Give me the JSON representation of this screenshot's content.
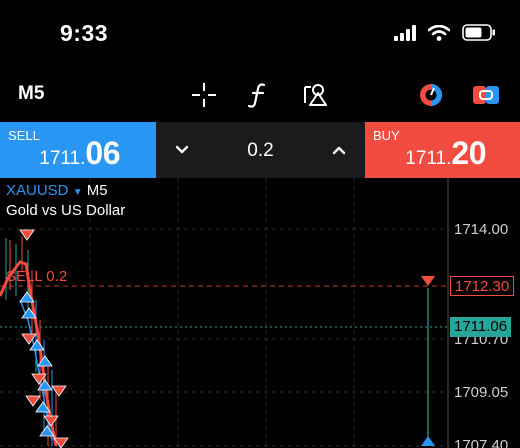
{
  "status_bar": {
    "time": "9:33",
    "icons": [
      "cellular-signal-icon",
      "wifi-icon",
      "battery-icon"
    ]
  },
  "toolbar": {
    "timeframe": "M5",
    "tools": [
      "crosshair-icon",
      "indicator-function-icon",
      "drawing-objects-icon",
      "trading-signals-icon",
      "trade-ideas-icon"
    ]
  },
  "trade_panel": {
    "sell": {
      "label": "SELL",
      "price_base": "1711.",
      "price_big": "06"
    },
    "quantity": "0.2",
    "buy": {
      "label": "BUY",
      "price_base": "1711.",
      "price_big": "20"
    }
  },
  "chart": {
    "symbol": "XAUUSD",
    "timeframe": "M5",
    "description": "Gold vs US Dollar",
    "sell_line_label": "SELL  0.2",
    "axis_labels": [
      "1714.00",
      "1710.70",
      "1709.05",
      "1707.40"
    ],
    "sell_tag": "1712.30",
    "current_tag": "1711.06",
    "colors": {
      "sell": "#f24b3f",
      "buy": "#2a96f3",
      "current": "#26a69a"
    }
  }
}
